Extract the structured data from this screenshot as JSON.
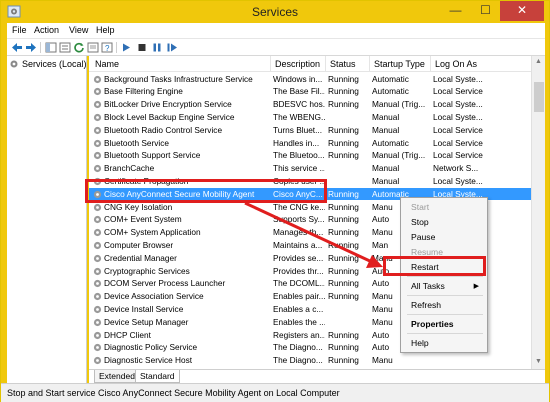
{
  "window": {
    "title": "Services"
  },
  "menu": [
    "File",
    "Action",
    "View",
    "Help"
  ],
  "toolbar": {
    "icons": [
      "back-arrow-icon",
      "forward-arrow-icon",
      "up-icon",
      "console-tree-icon",
      "refresh-icon",
      "properties-icon",
      "help-icon",
      "play-icon",
      "stop-icon",
      "pause-icon",
      "restart-icon"
    ],
    "accent": "#1e73be"
  },
  "tree": {
    "label": "Services (Local)"
  },
  "table": {
    "columns": [
      "Name",
      "Description",
      "Status",
      "Startup Type",
      "Log On As"
    ],
    "rows": [
      {
        "name": "Background Tasks Infrastructure Service",
        "description": "Windows in...",
        "status": "Running",
        "startup": "Automatic",
        "logon": "Local Syste..."
      },
      {
        "name": "Base Filtering Engine",
        "description": "The Base Fil...",
        "status": "Running",
        "startup": "Automatic",
        "logon": "Local Service"
      },
      {
        "name": "BitLocker Drive Encryption Service",
        "description": "BDESVC hos...",
        "status": "Running",
        "startup": "Manual (Trig...",
        "logon": "Local Syste..."
      },
      {
        "name": "Block Level Backup Engine Service",
        "description": "The WBENG...",
        "status": "",
        "startup": "Manual",
        "logon": "Local Syste..."
      },
      {
        "name": "Bluetooth Radio Control Service",
        "description": "Turns Bluet...",
        "status": "Running",
        "startup": "Manual",
        "logon": "Local Service"
      },
      {
        "name": "Bluetooth Service",
        "description": "Handles in...",
        "status": "Running",
        "startup": "Automatic",
        "logon": "Local Service"
      },
      {
        "name": "Bluetooth Support Service",
        "description": "The Bluetoo...",
        "status": "Running",
        "startup": "Manual (Trig...",
        "logon": "Local Service"
      },
      {
        "name": "BranchCache",
        "description": "This service ...",
        "status": "",
        "startup": "Manual",
        "logon": "Network S..."
      },
      {
        "name": "Certificate Propagation",
        "description": "Copies user ...",
        "status": "",
        "startup": "Manual",
        "logon": "Local Syste..."
      },
      {
        "name": "Cisco AnyConnect Secure Mobility Agent",
        "description": "Cisco AnyC...",
        "status": "Running",
        "startup": "Automatic",
        "logon": "Local Syste..."
      },
      {
        "name": "CNG Key Isolation",
        "description": "The CNG ke...",
        "status": "Running",
        "startup": "Manu",
        "logon": ""
      },
      {
        "name": "COM+ Event System",
        "description": "Supports Sy...",
        "status": "Running",
        "startup": "Auto",
        "logon": ""
      },
      {
        "name": "COM+ System Application",
        "description": "Manages th...",
        "status": "Running",
        "startup": "Manu",
        "logon": ""
      },
      {
        "name": "Computer Browser",
        "description": "Maintains a...",
        "status": "Running",
        "startup": "Man",
        "logon": ""
      },
      {
        "name": "Credential Manager",
        "description": "Provides se...",
        "status": "Running",
        "startup": "Manu",
        "logon": ""
      },
      {
        "name": "Cryptographic Services",
        "description": "Provides thr...",
        "status": "Running",
        "startup": "Auto",
        "logon": ""
      },
      {
        "name": "DCOM Server Process Launcher",
        "description": "The DCOML...",
        "status": "Running",
        "startup": "Auto",
        "logon": ""
      },
      {
        "name": "Device Association Service",
        "description": "Enables pair...",
        "status": "Running",
        "startup": "Manu",
        "logon": ""
      },
      {
        "name": "Device Install Service",
        "description": "Enables a c...",
        "status": "",
        "startup": "Manu",
        "logon": ""
      },
      {
        "name": "Device Setup Manager",
        "description": "Enables the ...",
        "status": "",
        "startup": "Manu",
        "logon": ""
      },
      {
        "name": "DHCP Client",
        "description": "Registers an...",
        "status": "Running",
        "startup": "Auto",
        "logon": ""
      },
      {
        "name": "Diagnostic Policy Service",
        "description": "The Diagno...",
        "status": "Running",
        "startup": "Auto",
        "logon": ""
      },
      {
        "name": "Diagnostic Service Host",
        "description": "The Diagno...",
        "status": "Running",
        "startup": "Manu",
        "logon": ""
      }
    ],
    "selected_row": 9
  },
  "context_menu": {
    "items": [
      {
        "label": "Start",
        "enabled": false
      },
      {
        "label": "Stop",
        "enabled": true
      },
      {
        "label": "Pause",
        "enabled": true
      },
      {
        "label": "Resume",
        "enabled": false
      },
      {
        "label": "Restart",
        "enabled": true,
        "highlighted": true
      },
      {
        "label": "All Tasks",
        "enabled": true,
        "submenu": true
      },
      {
        "label": "Refresh",
        "enabled": true
      },
      {
        "label": "Properties",
        "enabled": true,
        "bold": true
      },
      {
        "label": "Help",
        "enabled": true
      }
    ],
    "submenu_icon": "chevron-right-icon"
  },
  "tabs": [
    "Extended",
    "Standard"
  ],
  "active_tab": "Standard",
  "status_bar": {
    "text": "Stop and Start service Cisco AnyConnect Secure Mobility Agent on Local Computer"
  },
  "annotation": {
    "color": "#e01e1e",
    "icon": "arrow-icon"
  },
  "colors": {
    "title_bar": "#f0c80c",
    "selection": "#3399ff",
    "close_button": "#c7413b"
  }
}
